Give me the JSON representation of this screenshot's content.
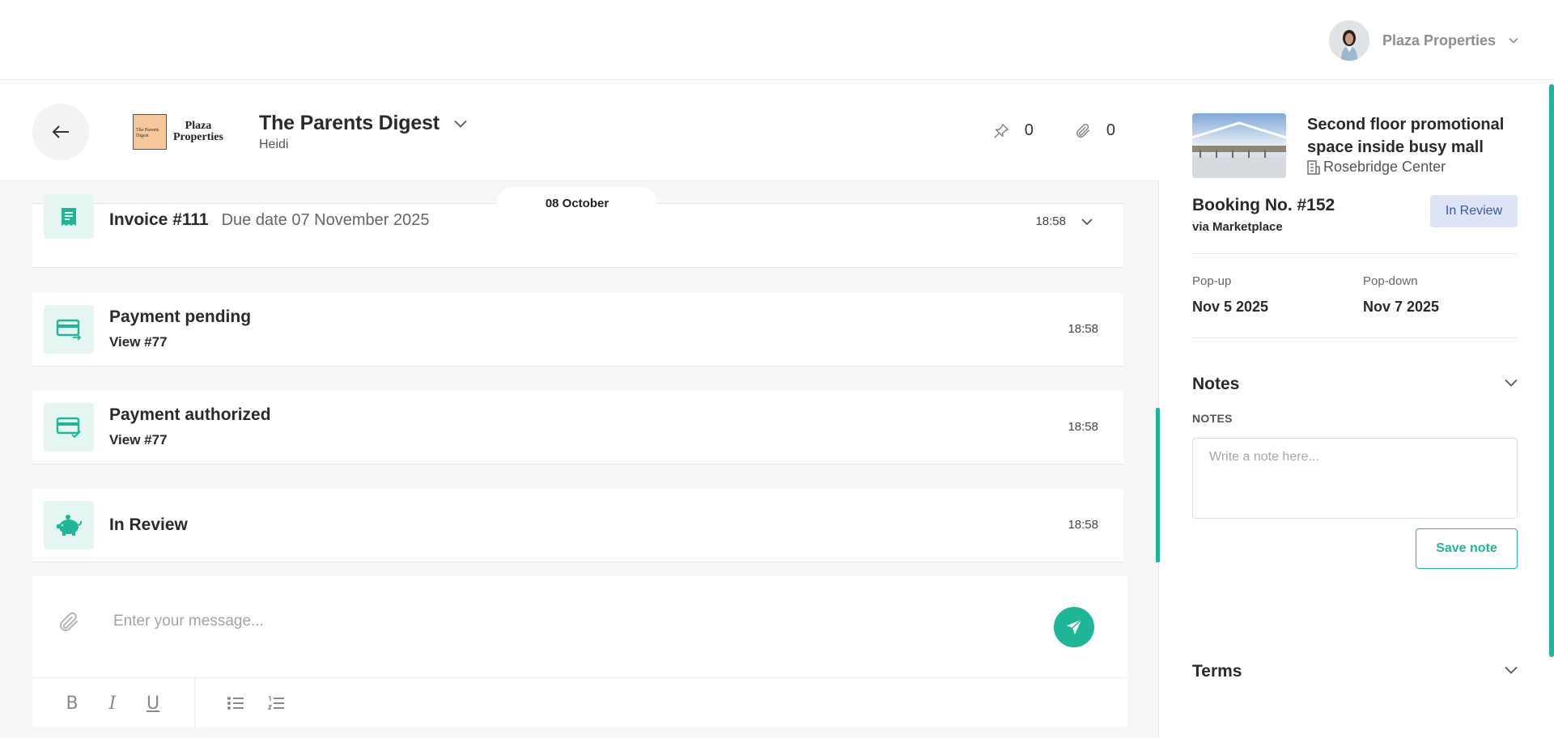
{
  "account": {
    "name": "Plaza Properties"
  },
  "header": {
    "brand_line1": "Plaza",
    "brand_line2": "Properties",
    "logo_text": "The Parents Digest",
    "title": "The Parents Digest",
    "subtitle": "Heidi",
    "pins": "0",
    "attachments": "0"
  },
  "date_divider": "08 October",
  "events": [
    {
      "title": "Invoice #111",
      "detail": "Due date 07 November 2025",
      "time": "18:58",
      "icon": "receipt-icon"
    },
    {
      "title": "Payment pending",
      "detail": "View #77",
      "time": "18:58",
      "icon": "card-arrow-icon"
    },
    {
      "title": "Payment authorized",
      "detail": "View #77",
      "time": "18:58",
      "icon": "card-check-icon"
    },
    {
      "title": "In Review",
      "time": "18:58",
      "icon": "piggy-bank-icon"
    }
  ],
  "composer": {
    "placeholder": "Enter your message..."
  },
  "panel": {
    "listing_title": "Second floor promotional space inside busy mall",
    "location": "Rosebridge Center",
    "booking_no": "Booking No. #152",
    "via": "via Marketplace",
    "status": "In Review",
    "popup_label": "Pop-up",
    "popup_date": "Nov 5 2025",
    "popdown_label": "Pop-down",
    "popdown_date": "Nov 7 2025",
    "notes_title": "Notes",
    "notes_label": "NOTES",
    "notes_placeholder": "Write a note here...",
    "save_label": "Save note",
    "terms_title": "Terms"
  },
  "colors": {
    "accent": "#1fb597",
    "status_bg": "#dde4f6",
    "status_text": "#3b55a3"
  }
}
